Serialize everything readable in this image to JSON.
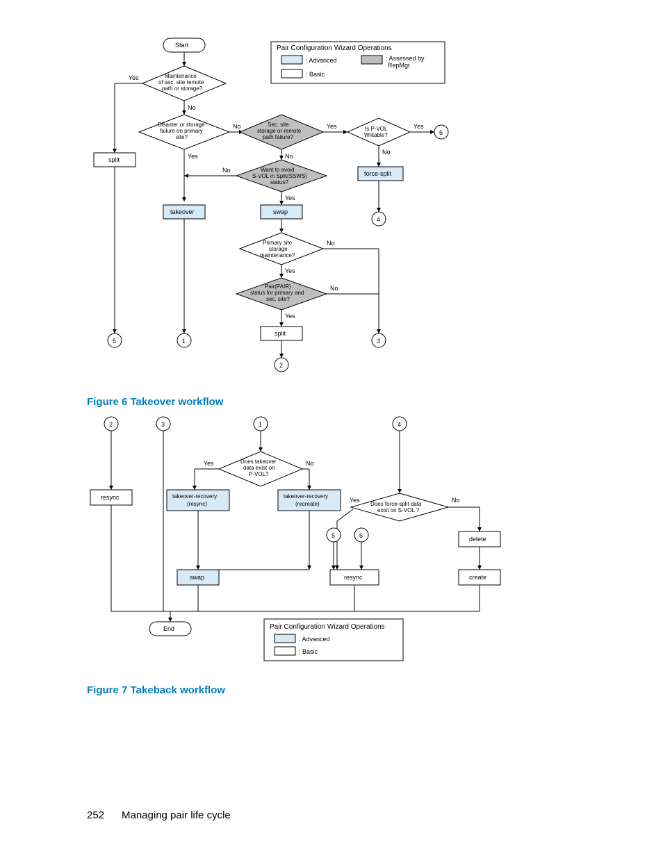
{
  "figure6": {
    "caption": "Figure 6 Takeover workflow",
    "nodes": {
      "start": "Start",
      "d_maint": "Maintenance\nof sec. site remote\npath or storage?",
      "d_disaster": "Disaster or storage\nfailure on primary\nsite?",
      "d_secsite": "Sec. site\nstorage or remote\npath failure?",
      "d_pvol": "Is P-VOL\nWritable?",
      "d_avoid": "Want to avoid\nS-VOL in Split(SSWS)\nstatus?",
      "d_primmaint": "Primary site\nstorage\nmaintenance?",
      "d_pair": "Pair(PAIR)\nstatus for primary and\nsec. site?",
      "split": "split",
      "takeover": "takeover",
      "swap": "swap",
      "force_split": "force-split",
      "split2": "split",
      "c1": "1",
      "c2": "2",
      "c3": "3",
      "c4": "4",
      "c5": "5",
      "c6": "6"
    },
    "edges": {
      "yes": "Yes",
      "no": "No"
    },
    "legend": {
      "title": "Pair Configuration Wizard Operations",
      "advanced": ": Advanced",
      "assessed": ": Assessed by\nRepMgr",
      "basic": ": Basic"
    }
  },
  "figure7": {
    "caption": "Figure 7 Takeback workflow",
    "nodes": {
      "d_takeover": "Does takeover\ndata exist on\nP-VOL?",
      "d_forcesplit": "Does force-split data\nexist on S-VOL ?",
      "resync1": "resync",
      "tr_resync": "takeover-recovery\n(resync)",
      "tr_recreate": "takeover-recovery\n(recreate)",
      "swap": "swap",
      "delete": "delete",
      "resync2": "resync",
      "create": "create",
      "end": "End",
      "c1": "1",
      "c2": "2",
      "c3": "3",
      "c4": "4",
      "c5": "5",
      "c6": "6"
    },
    "edges": {
      "yes": "Yes",
      "no": "No"
    },
    "legend": {
      "title": "Pair Configuration Wizard Operations",
      "advanced": ": Advanced",
      "basic": ": Basic"
    }
  },
  "footer": {
    "page": "252",
    "title": "Managing pair life cycle"
  }
}
